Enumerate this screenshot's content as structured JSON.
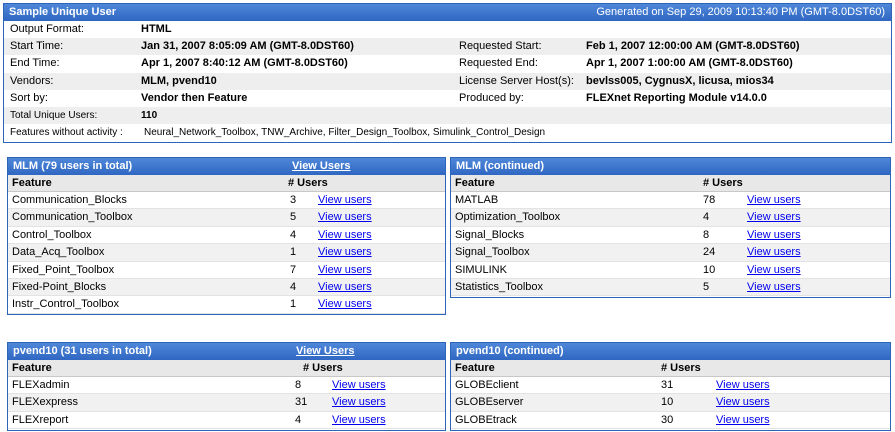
{
  "summary": {
    "title": "Sample Unique User",
    "generated": "Generated on Sep 29, 2009 10:13:40 PM (GMT-8.0DST60)",
    "output_format_label": "Output Format:",
    "output_format": "HTML",
    "start_time_label": "Start Time:",
    "start_time": "Jan 31, 2007 8:05:09 AM (GMT-8.0DST60)",
    "requested_start_label": "Requested Start:",
    "requested_start": "Feb 1, 2007 12:00:00 AM (GMT-8.0DST60)",
    "end_time_label": "End Time:",
    "end_time": "Apr 1, 2007 8:40:12 AM (GMT-8.0DST60)",
    "requested_end_label": "Requested End:",
    "requested_end": "Apr 1, 2007 1:00:00 AM (GMT-8.0DST60)",
    "vendors_label": "Vendors:",
    "vendors": "MLM, pvend10",
    "license_hosts_label": "License Server Host(s):",
    "license_hosts": "bevlss005, CygnusX, licusa, mios34",
    "sort_label": "Sort by:",
    "sort": "Vendor then Feature",
    "produced_label": "Produced by:",
    "produced": "FLEXnet Reporting Module v14.0.0",
    "total_label": "Total Unique Users:",
    "total": "110",
    "inactive_label": "Features without activity :",
    "inactive": "Neural_Network_Toolbox, TNW_Archive, Filter_Design_Toolbox, Simulink_Control_Design"
  },
  "headers": {
    "feature": "Feature",
    "users": "# Users"
  },
  "view_users": "View users",
  "mlm": {
    "title": "MLM (79 users in total)",
    "view_all": "View Users",
    "rows": [
      {
        "feature": "Communication_Blocks",
        "users": "3"
      },
      {
        "feature": "Communication_Toolbox",
        "users": "5"
      },
      {
        "feature": "Control_Toolbox",
        "users": "4"
      },
      {
        "feature": "Data_Acq_Toolbox",
        "users": "1"
      },
      {
        "feature": "Fixed_Point_Toolbox",
        "users": "7"
      },
      {
        "feature": "Fixed-Point_Blocks",
        "users": "4"
      },
      {
        "feature": "Instr_Control_Toolbox",
        "users": "1"
      }
    ]
  },
  "mlm_cont": {
    "title": "MLM (continued)",
    "rows": [
      {
        "feature": "MATLAB",
        "users": "78"
      },
      {
        "feature": "Optimization_Toolbox",
        "users": "4"
      },
      {
        "feature": "Signal_Blocks",
        "users": "8"
      },
      {
        "feature": "Signal_Toolbox",
        "users": "24"
      },
      {
        "feature": "SIMULINK",
        "users": "10"
      },
      {
        "feature": "Statistics_Toolbox",
        "users": "5"
      }
    ]
  },
  "pvend": {
    "title": "pvend10 (31 users in total)",
    "view_all": "View Users",
    "rows": [
      {
        "feature": "FLEXadmin",
        "users": "8"
      },
      {
        "feature": "FLEXexpress",
        "users": "31"
      },
      {
        "feature": "FLEXreport",
        "users": "4"
      }
    ]
  },
  "pvend_cont": {
    "title": "pvend10 (continued)",
    "rows": [
      {
        "feature": "GLOBEclient",
        "users": "31"
      },
      {
        "feature": "GLOBEserver",
        "users": "10"
      },
      {
        "feature": "GLOBEtrack",
        "users": "30"
      }
    ]
  }
}
